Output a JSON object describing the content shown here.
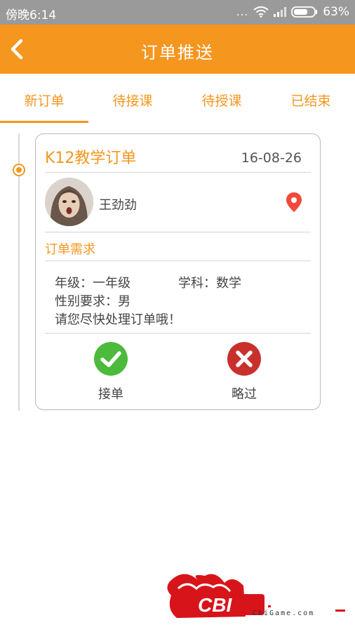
{
  "status_bar": {
    "time": "傍晚6:14",
    "dots": "...",
    "battery_percent": "63%"
  },
  "app_bar": {
    "title": "订单推送"
  },
  "tabs": [
    {
      "label": "新订单",
      "selected": true
    },
    {
      "label": "待接课",
      "selected": false
    },
    {
      "label": "待授课",
      "selected": false
    },
    {
      "label": "已结束",
      "selected": false
    }
  ],
  "order": {
    "title": "K12教学订单",
    "date": "16-08-26",
    "user_name": "王劲劲",
    "requirements_label": "订单需求",
    "grade": "年级：一年级",
    "subject": "学科：数学",
    "gender": "性别要求：男",
    "note": "请您尽快处理订单哦！",
    "accept_label": "接单",
    "skip_label": "略过"
  },
  "watermark": {
    "logo_text": "CBI",
    "url": "CbiGame.com"
  },
  "colors": {
    "accent": "#f5961f",
    "accept": "#4cba3a",
    "skip": "#c9302c",
    "status_bar": "#9a9a9a"
  }
}
